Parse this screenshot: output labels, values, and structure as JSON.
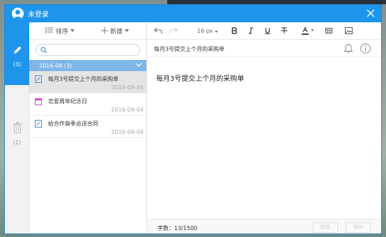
{
  "window": {
    "title": "未登录"
  },
  "rail": {
    "notes_count": "(3)",
    "trash_count": "(1)"
  },
  "list": {
    "sort_label": "排序",
    "new_label": "新建",
    "search_placeholder": "",
    "group_label": "2016-08 (3)",
    "notes": [
      {
        "title": "每月3号提交上个月的采购单",
        "date": "2016-08-04",
        "icon": "note-icon"
      },
      {
        "title": "恋爱周年纪念日",
        "date": "2016-08-04",
        "icon": "calendar-icon"
      },
      {
        "title": "给合作商季总送合同",
        "date": "2016-08-04",
        "icon": "note-icon"
      }
    ]
  },
  "editor": {
    "font_size": "16 px",
    "subject": "每月3号提交上个月的采购单",
    "content": "每月3号提交上个月的采购单",
    "word_count": "字数：13/1500",
    "cancel_label": "取消",
    "save_label": "保存"
  },
  "colors": {
    "titlebar": "#1e95ea",
    "group": "#7fb6e8",
    "selected_row": "#e4e4e4"
  }
}
